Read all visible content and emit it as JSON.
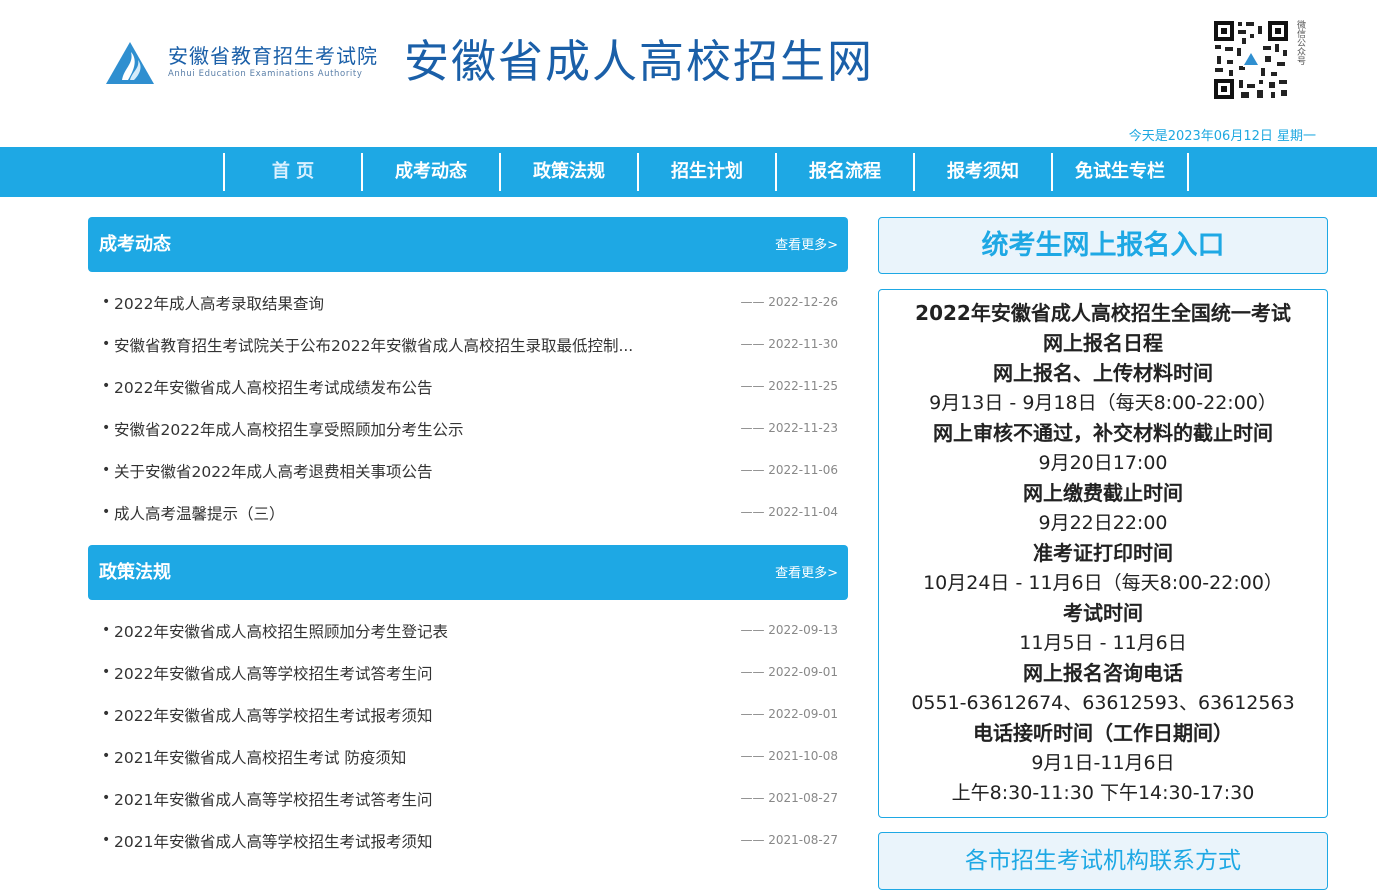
{
  "header": {
    "org_cn": "安徽省教育招生考试院",
    "org_en": "Anhui Education Examinations Authority",
    "site_title": "安徽省成人高校招生网",
    "qr_label": "微信公众号",
    "today": "今天是2023年06月12日 星期一",
    "logo_icon": "mountain-logo-icon",
    "qr_icon": "qr-code-icon"
  },
  "nav": {
    "items": [
      {
        "label": "首 页",
        "active": true
      },
      {
        "label": "成考动态"
      },
      {
        "label": "政策法规"
      },
      {
        "label": "招生计划"
      },
      {
        "label": "报名流程"
      },
      {
        "label": "报考须知"
      },
      {
        "label": "免试生专栏"
      }
    ]
  },
  "sections": [
    {
      "title": "成考动态",
      "more": "查看更多>",
      "items": [
        {
          "title": "2022年成人高考录取结果查询",
          "date": "—— 2022-12-26"
        },
        {
          "title": "安徽省教育招生考试院关于公布2022年安徽省成人高校招生录取最低控制...",
          "date": "—— 2022-11-30"
        },
        {
          "title": "2022年安徽省成人高校招生考试成绩发布公告",
          "date": "—— 2022-11-25"
        },
        {
          "title": "安徽省2022年成人高校招生享受照顾加分考生公示",
          "date": "—— 2022-11-23"
        },
        {
          "title": "关于安徽省2022年成人高考退费相关事项公告",
          "date": "—— 2022-11-06"
        },
        {
          "title": "成人高考温馨提示（三）",
          "date": "—— 2022-11-04"
        }
      ]
    },
    {
      "title": "政策法规",
      "more": "查看更多>",
      "items": [
        {
          "title": "2022年安徽省成人高校招生照顾加分考生登记表",
          "date": "—— 2022-09-13"
        },
        {
          "title": "2022年安徽省成人高等学校招生考试答考生问",
          "date": "—— 2022-09-01"
        },
        {
          "title": "2022年安徽省成人高等学校招生考试报考须知",
          "date": "—— 2022-09-01"
        },
        {
          "title": "2021年安徽省成人高校招生考试 防疫须知",
          "date": "—— 2021-10-08"
        },
        {
          "title": "2021年安徽省成人高等学校招生考试答考生问",
          "date": "—— 2021-08-27"
        },
        {
          "title": "2021年安徽省成人高等学校招生考试报考须知",
          "date": "—— 2021-08-27"
        }
      ]
    }
  ],
  "right": {
    "entry_label": "统考生网上报名入口",
    "schedule": [
      {
        "text": "2022年安徽省成人高校招生全国统一考试",
        "bold": true
      },
      {
        "text": "网上报名日程",
        "bold": true
      },
      {
        "text": "网上报名、上传材料时间",
        "bold": true
      },
      {
        "text": "9月13日 - 9月18日（每天8:00-22:00）",
        "bold": false
      },
      {
        "text": "网上审核不通过，补交材料的截止时间",
        "bold": true
      },
      {
        "text": "9月20日17:00",
        "bold": false
      },
      {
        "text": "网上缴费截止时间",
        "bold": true
      },
      {
        "text": "9月22日22:00",
        "bold": false
      },
      {
        "text": "准考证打印时间",
        "bold": true
      },
      {
        "text": "10月24日 - 11月6日（每天8:00-22:00）",
        "bold": false
      },
      {
        "text": "考试时间",
        "bold": true
      },
      {
        "text": "11月5日 - 11月6日",
        "bold": false
      },
      {
        "text": "网上报名咨询电话",
        "bold": true
      },
      {
        "text": "0551-63612674、63612593、63612563",
        "bold": false
      },
      {
        "text": "电话接听时间（工作日期间）",
        "bold": true
      },
      {
        "text": "9月1日-11月6日",
        "bold": false
      },
      {
        "text": "上午8:30-11:30 下午14:30-17:30",
        "bold": false
      }
    ],
    "contact_label": "各市招生考试机构联系方式"
  }
}
